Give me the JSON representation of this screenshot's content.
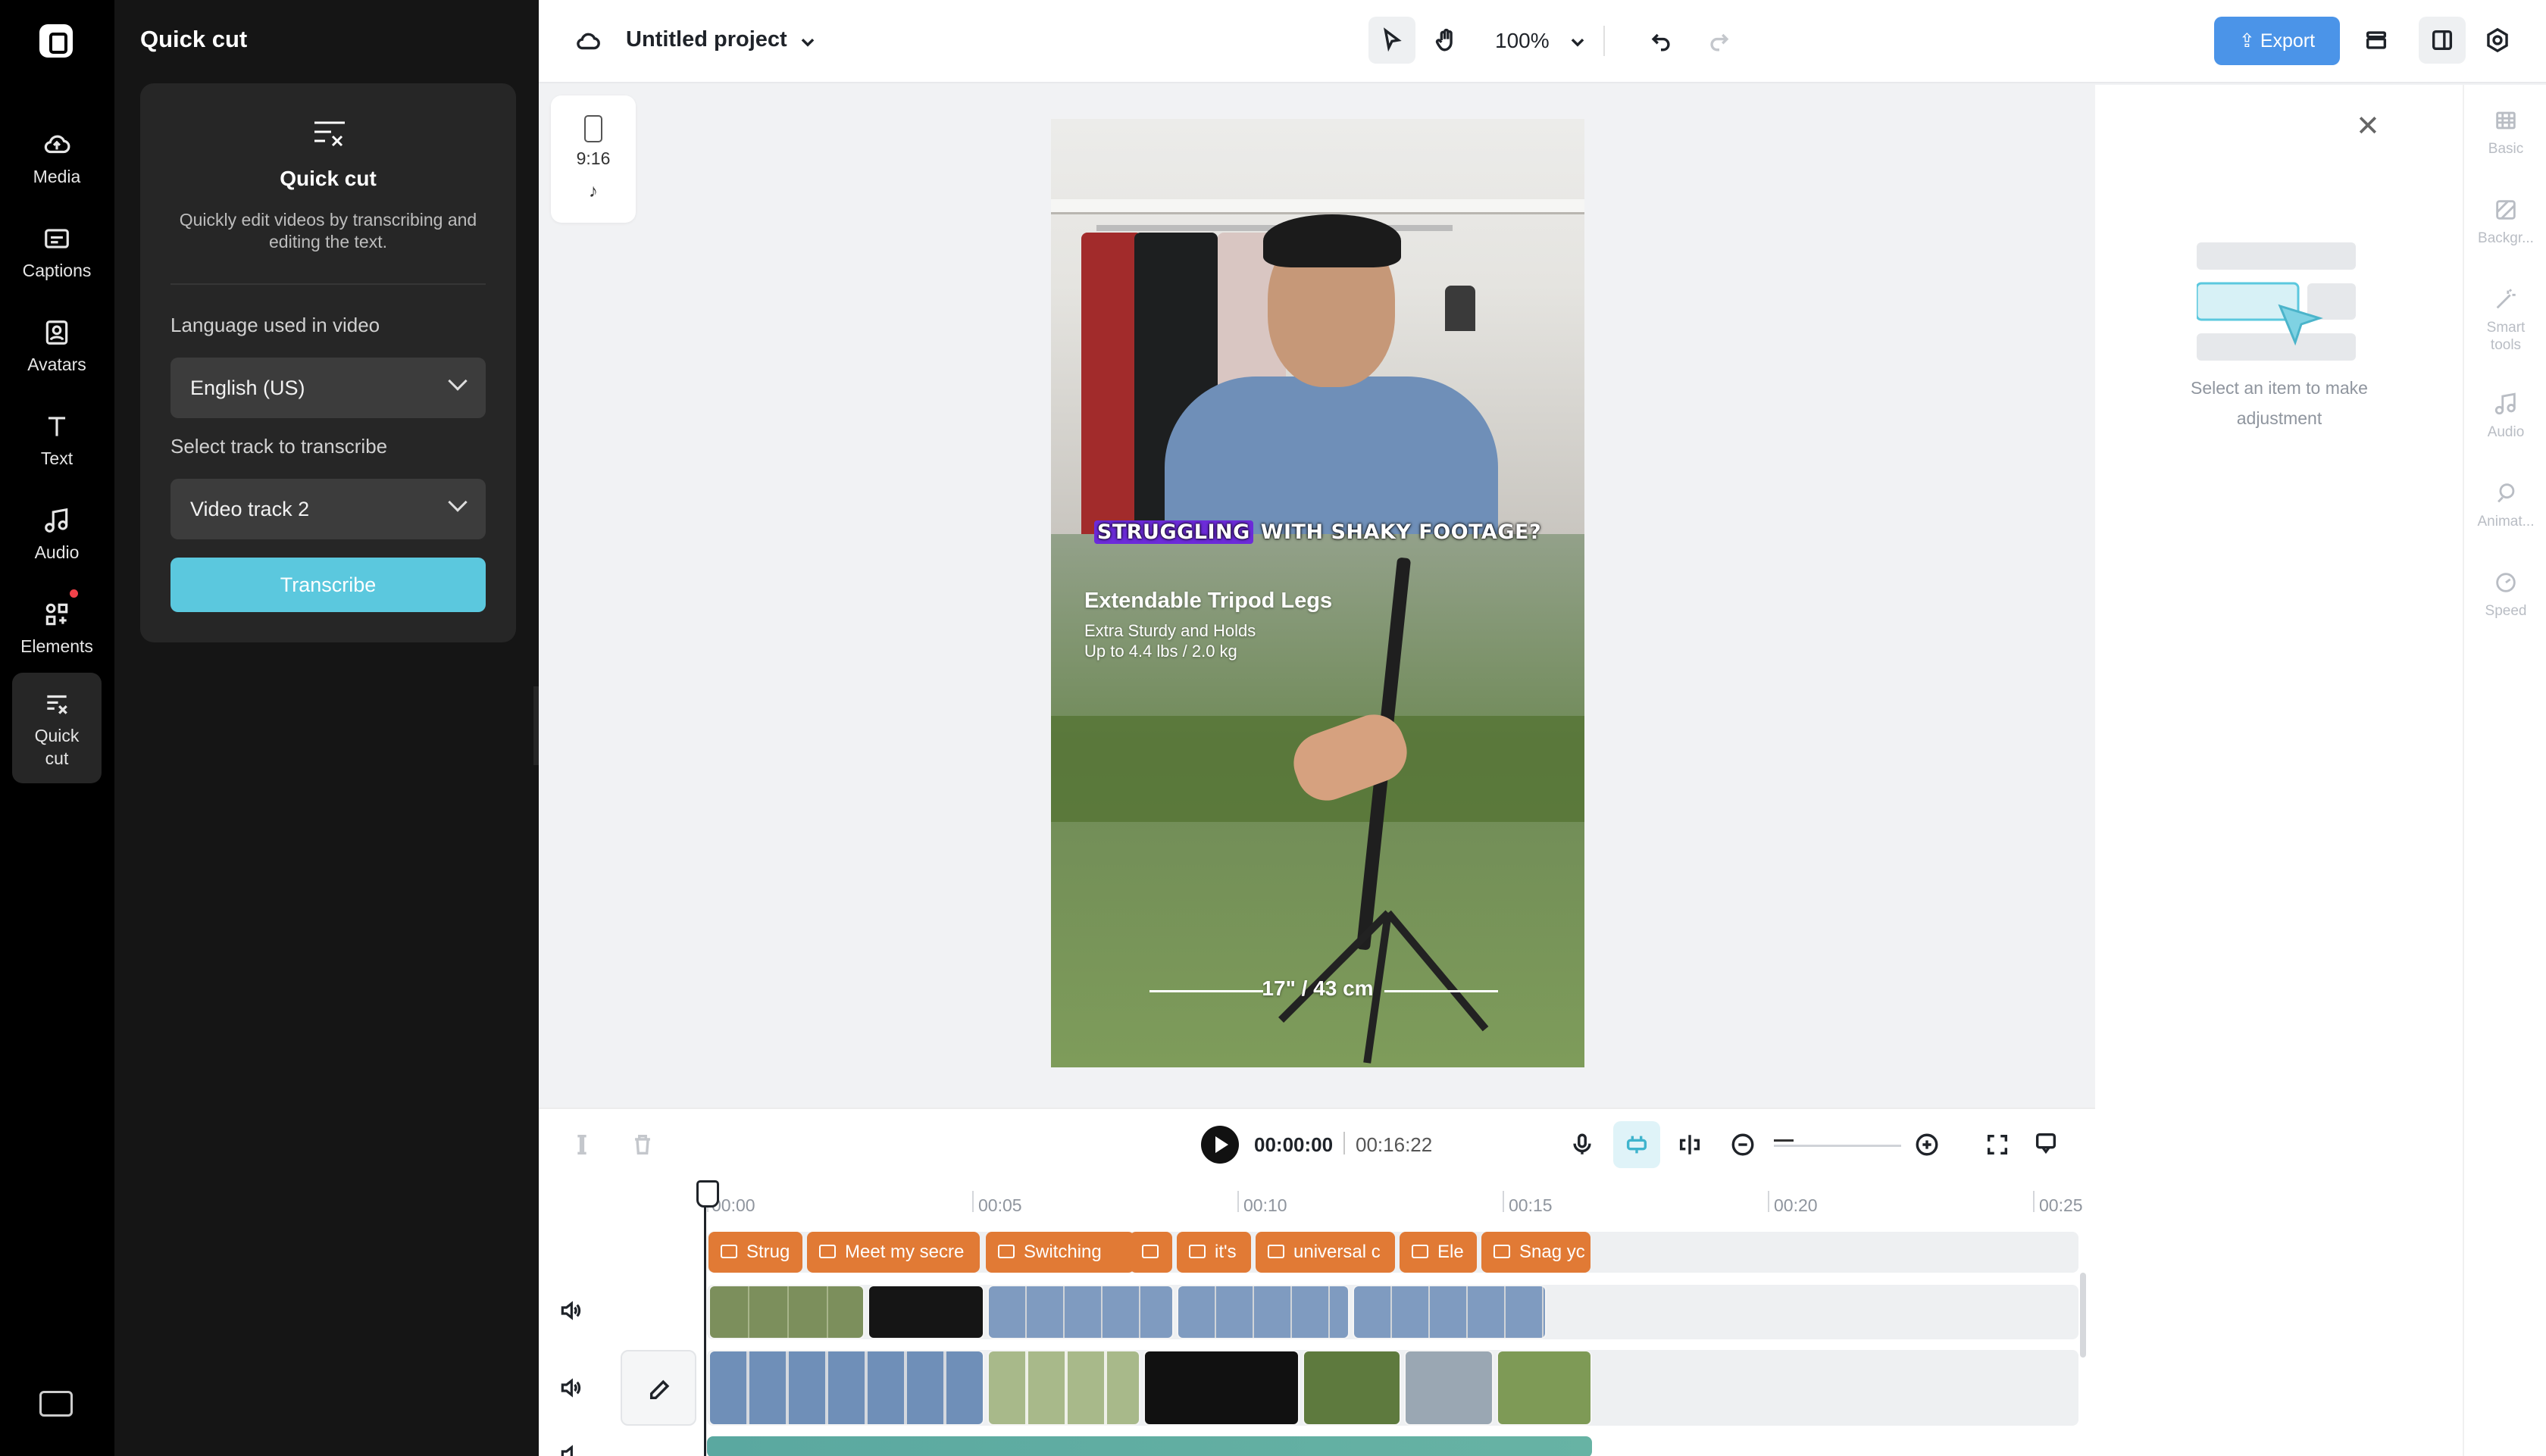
{
  "rail": {
    "items": [
      {
        "label": "Media",
        "icon": "cloud-upload-icon"
      },
      {
        "label": "Captions",
        "icon": "captions-icon"
      },
      {
        "label": "Avatars",
        "icon": "avatar-icon"
      },
      {
        "label": "Text",
        "icon": "text-icon"
      },
      {
        "label": "Audio",
        "icon": "music-note-icon"
      },
      {
        "label": "Elements",
        "icon": "elements-icon"
      },
      {
        "label": "Quick cut",
        "icon": "quick-cut-icon"
      }
    ],
    "active": "Quick cut"
  },
  "panel": {
    "title": "Quick cut",
    "card_title": "Quick cut",
    "card_desc": "Quickly edit videos by transcribing and editing the text.",
    "language_label": "Language used in video",
    "language_value": "English (US)",
    "track_label": "Select track to transcribe",
    "track_value": "Video track 2",
    "transcribe_label": "Transcribe"
  },
  "topbar": {
    "project_name": "Untitled project",
    "zoom": "100%",
    "export_label": "Export"
  },
  "canvas": {
    "ratio": "9:16",
    "caption_highlight": "STRUGGLING",
    "caption_rest": " WITH SHAKY FOOTAGE?",
    "promo_title": "Extendable Tripod Legs",
    "promo_sub_1": "Extra Sturdy and Holds",
    "promo_sub_2": "Up to 4.4 lbs / 2.0 kg",
    "measure": "17\" / 43 cm"
  },
  "right_panel": {
    "hint": "Select an item to make adjustment",
    "tabs": [
      "Basic",
      "Backgr...",
      "Smart tools",
      "Audio",
      "Animat...",
      "Speed"
    ]
  },
  "timeline": {
    "current_time": "00:00:00",
    "total_time": "00:16:22",
    "ruler": [
      "00:00",
      "00:05",
      "00:10",
      "00:15",
      "00:20",
      "00:25"
    ],
    "captions": [
      "Strug",
      "Meet my secre",
      "Switching",
      "",
      "it's",
      "universal c",
      "Ele",
      "Snag yc"
    ]
  },
  "colors": {
    "accent": "#4b94e8",
    "transcribe": "#5bc8de",
    "caption_chip": "#e17a35",
    "caption_highlight": "#6c2bd9"
  }
}
